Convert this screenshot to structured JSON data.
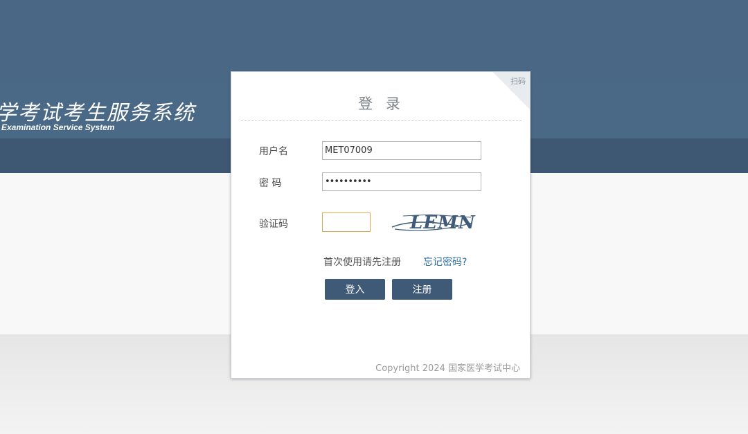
{
  "header": {
    "title": "学考试考生服务系统",
    "subtitle": "Examination Service System"
  },
  "login": {
    "corner_label": "扫码",
    "title": "登 录",
    "username_label": "用户名",
    "username_value": "MET07009",
    "password_label": "密 码",
    "password_value": "••••••••••",
    "captcha_label": "验证码",
    "captcha_value": "",
    "captcha_text": "LEMN",
    "register_hint": "首次使用请先注册",
    "forgot_link": "忘记密码?",
    "login_button": "登入",
    "register_button": "注册",
    "copyright": "Copyright 2024 国家医学考试中心"
  },
  "colors": {
    "header_bg": "#496987",
    "button_bg": "#3f5a76",
    "link": "#2f6ea5",
    "captcha_focus": "#e0a94c"
  }
}
